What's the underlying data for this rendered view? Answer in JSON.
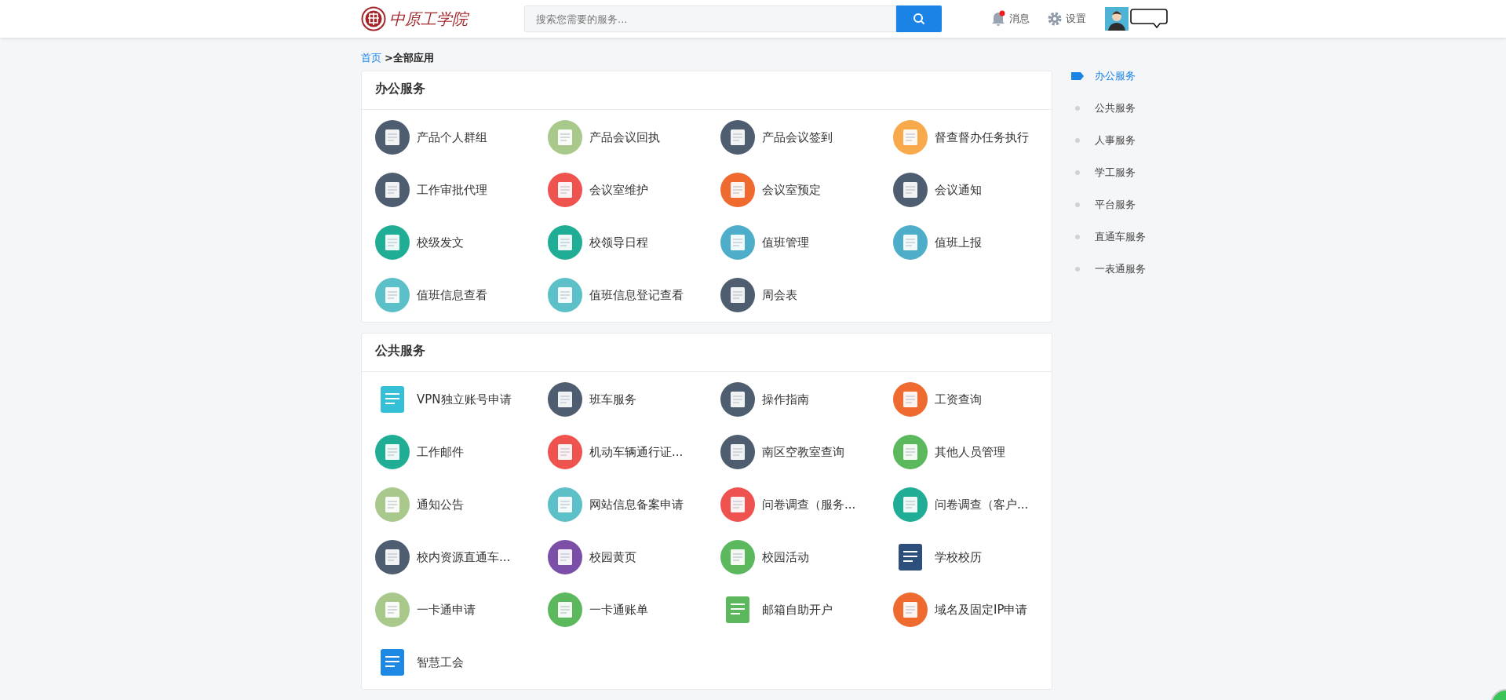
{
  "header": {
    "logo_text": "中原工学院",
    "search": {
      "placeholder": "搜索您需要的服务..."
    },
    "messages": {
      "label": "消息",
      "unread": true
    },
    "settings": {
      "label": "设置"
    }
  },
  "breadcrumb": [
    {
      "label": "首页",
      "kind": "link"
    },
    {
      "label": ">全部应用",
      "kind": "current"
    }
  ],
  "sections": [
    {
      "title": "办公服务",
      "apps": [
        {
          "label": "产品个人群组",
          "color": "#4e5d70",
          "kind": "round"
        },
        {
          "label": "产品会议回执",
          "color": "#a9c98c",
          "kind": "round"
        },
        {
          "label": "产品会议签到",
          "color": "#4e5d70",
          "kind": "round"
        },
        {
          "label": "督查督办任务执行",
          "color": "#f7a94b",
          "kind": "round"
        },
        {
          "label": "工作审批代理",
          "color": "#4e5d70",
          "kind": "round"
        },
        {
          "label": "会议室维护",
          "color": "#ef5350",
          "kind": "round"
        },
        {
          "label": "会议室预定",
          "color": "#ee6a2e",
          "kind": "round"
        },
        {
          "label": "会议通知",
          "color": "#4e5d70",
          "kind": "round"
        },
        {
          "label": "校级发文",
          "color": "#1fae95",
          "kind": "round"
        },
        {
          "label": "校领导日程",
          "color": "#1fae95",
          "kind": "round"
        },
        {
          "label": "值班管理",
          "color": "#4eadc9",
          "kind": "round"
        },
        {
          "label": "值班上报",
          "color": "#4eadc9",
          "kind": "round"
        },
        {
          "label": "值班信息查看",
          "color": "#5bc0c8",
          "kind": "round"
        },
        {
          "label": "值班信息登记查看",
          "color": "#5bc0c8",
          "kind": "round"
        },
        {
          "label": "周会表",
          "color": "#4e5d70",
          "kind": "round"
        }
      ]
    },
    {
      "title": "公共服务",
      "apps": [
        {
          "label": "VPN独立账号申请",
          "color": "#35c0d8",
          "kind": "flat"
        },
        {
          "label": "班车服务",
          "color": "#4e5d70",
          "kind": "round"
        },
        {
          "label": "操作指南",
          "color": "#4e5d70",
          "kind": "round"
        },
        {
          "label": "工资查询",
          "color": "#ee6a2e",
          "kind": "round"
        },
        {
          "label": "工作邮件",
          "color": "#1fae95",
          "kind": "round"
        },
        {
          "label": "机动车辆通行证...",
          "color": "#ef5350",
          "kind": "round"
        },
        {
          "label": "南区空教室查询",
          "color": "#4e5d70",
          "kind": "round"
        },
        {
          "label": "其他人员管理",
          "color": "#5cb85c",
          "kind": "round"
        },
        {
          "label": "通知公告",
          "color": "#a9c98c",
          "kind": "round"
        },
        {
          "label": "网站信息备案申请",
          "color": "#5bc0c8",
          "kind": "round"
        },
        {
          "label": "问卷调查（服务...",
          "color": "#ef5350",
          "kind": "round"
        },
        {
          "label": "问卷调查（客户...",
          "color": "#1fae95",
          "kind": "round"
        },
        {
          "label": "校内资源直通车...",
          "color": "#4e5d70",
          "kind": "round"
        },
        {
          "label": "校园黄页",
          "color": "#7b4fa8",
          "kind": "round"
        },
        {
          "label": "校园活动",
          "color": "#5cb85c",
          "kind": "round"
        },
        {
          "label": "学校校历",
          "color": "#2c4f7c",
          "kind": "flat"
        },
        {
          "label": "一卡通申请",
          "color": "#a9c98c",
          "kind": "round"
        },
        {
          "label": "一卡通账单",
          "color": "#5cb85c",
          "kind": "round"
        },
        {
          "label": "邮箱自助开户",
          "color": "#5cb85c",
          "kind": "flat"
        },
        {
          "label": "域名及固定IP申请",
          "color": "#ee6a2e",
          "kind": "round"
        },
        {
          "label": "智慧工会",
          "color": "#1e88e5",
          "kind": "flat"
        }
      ]
    }
  ],
  "side_nav": [
    {
      "label": "办公服务",
      "selected": true
    },
    {
      "label": "公共服务",
      "selected": false
    },
    {
      "label": "人事服务",
      "selected": false
    },
    {
      "label": "学工服务",
      "selected": false
    },
    {
      "label": "平台服务",
      "selected": false
    },
    {
      "label": "直通车服务",
      "selected": false
    },
    {
      "label": "一表通服务",
      "selected": false
    }
  ]
}
